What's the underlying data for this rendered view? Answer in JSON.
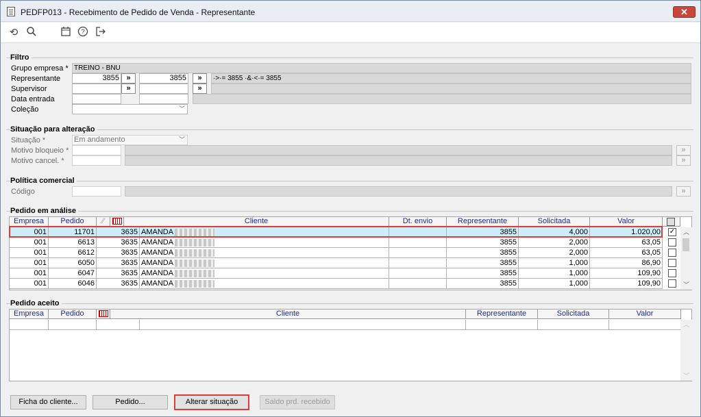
{
  "window": {
    "title": "PEDFP013 - Recebimento de Pedido de Venda - Representante",
    "close_label": "✕"
  },
  "toolbar": {
    "items": [
      "refresh-icon",
      "search-icon",
      "calendar-icon",
      "help-icon",
      "exit-icon"
    ]
  },
  "filtro": {
    "legend": "Filtro",
    "grupo_label": "Grupo empresa *",
    "grupo_value": "TREINO - BNU",
    "rep_label": "Representante",
    "rep_from": "3855",
    "rep_to": "3855",
    "rep_expr": "·>·= 3855 ·&·<·= 3855",
    "sup_label": "Supervisor",
    "data_label": "Data entrada",
    "colecao_label": "Coleção",
    "arrow": "»"
  },
  "situacao": {
    "legend": "Situação para alteração",
    "sit_label": "Situação *",
    "sit_value": "Em andamento",
    "bloq_label": "Motivo bloqueio *",
    "cancel_label": "Motivo cancel. *"
  },
  "politica": {
    "legend": "Política comercial",
    "codigo_label": "Código"
  },
  "analise": {
    "legend": "Pedido em análise",
    "headers": [
      "Empresa",
      "Pedido",
      "",
      "",
      "Cliente",
      "Dt. envio",
      "Representante",
      "Solicitada",
      "Valor"
    ],
    "rows": [
      {
        "empresa": "001",
        "pedido": "11701",
        "cod": "3635",
        "cliente": "AMANDA",
        "dt": "",
        "rep": "3855",
        "sol": "4,000",
        "valor": "1.020,00",
        "checked": "✓"
      },
      {
        "empresa": "001",
        "pedido": "6613",
        "cod": "3635",
        "cliente": "AMANDA",
        "dt": "",
        "rep": "3855",
        "sol": "2,000",
        "valor": "63,05",
        "checked": ""
      },
      {
        "empresa": "001",
        "pedido": "6612",
        "cod": "3635",
        "cliente": "AMANDA",
        "dt": "",
        "rep": "3855",
        "sol": "2,000",
        "valor": "63,05",
        "checked": ""
      },
      {
        "empresa": "001",
        "pedido": "6050",
        "cod": "3635",
        "cliente": "AMANDA",
        "dt": "",
        "rep": "3855",
        "sol": "1,000",
        "valor": "86,90",
        "checked": ""
      },
      {
        "empresa": "001",
        "pedido": "6047",
        "cod": "3635",
        "cliente": "AMANDA",
        "dt": "",
        "rep": "3855",
        "sol": "1,000",
        "valor": "109,90",
        "checked": ""
      },
      {
        "empresa": "001",
        "pedido": "6046",
        "cod": "3635",
        "cliente": "AMANDA",
        "dt": "",
        "rep": "3855",
        "sol": "1,000",
        "valor": "109,90",
        "checked": ""
      }
    ]
  },
  "aceito": {
    "legend": "Pedido aceito",
    "headers": [
      "Empresa",
      "Pedido",
      "",
      "Cliente",
      "Representante",
      "Solicitada",
      "Valor"
    ]
  },
  "buttons": {
    "ficha": "Ficha do cliente...",
    "pedido": "Pedido...",
    "alterar": "Alterar situação",
    "saldo": "Saldo prd. recebido"
  },
  "colors": {
    "highlight_row": "#cdeef9",
    "callout": "#e03a3a",
    "header_text": "#1c2a8e"
  }
}
